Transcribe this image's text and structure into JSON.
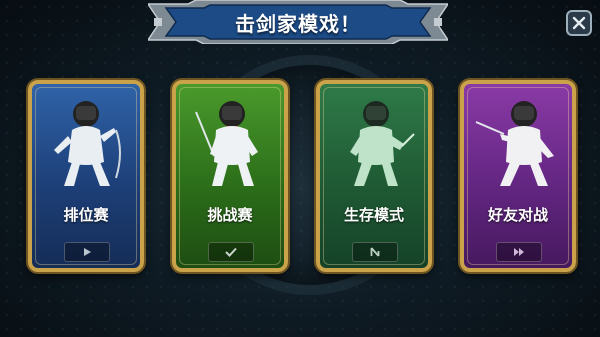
{
  "header": {
    "title": "击剑家模戏！"
  },
  "close": {
    "icon": "close-icon"
  },
  "modes": [
    {
      "label": "排位赛",
      "icon": "play-icon",
      "color": "#2f63a8"
    },
    {
      "label": "挑战赛",
      "icon": "check-icon",
      "color": "#4a9a2c"
    },
    {
      "label": "生存模式",
      "icon": "survival-icon",
      "color": "#2f7a48"
    },
    {
      "label": "好友对战",
      "icon": "versus-icon",
      "color": "#8a3aa6"
    }
  ]
}
